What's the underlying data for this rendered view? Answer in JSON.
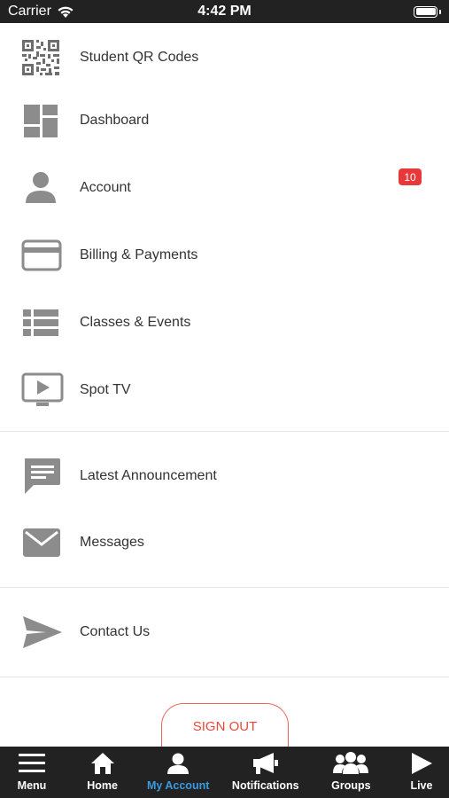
{
  "status_bar": {
    "carrier": "Carrier",
    "time": "4:42 PM"
  },
  "menu": {
    "items": [
      {
        "label": "Student QR Codes",
        "icon": "qr-code-icon"
      },
      {
        "label": "Dashboard",
        "icon": "dashboard-icon"
      },
      {
        "label": "Account",
        "icon": "person-icon",
        "badge": "10"
      },
      {
        "label": "Billing & Payments",
        "icon": "credit-card-icon"
      },
      {
        "label": "Classes & Events",
        "icon": "list-icon"
      },
      {
        "label": "Spot TV",
        "icon": "tv-play-icon"
      },
      {
        "label": "Latest Announcement",
        "icon": "announcement-icon"
      },
      {
        "label": "Messages",
        "icon": "envelope-icon"
      },
      {
        "label": "Contact Us",
        "icon": "send-icon"
      }
    ]
  },
  "sign_out_label": "SIGN OUT",
  "tab_bar": {
    "tabs": [
      {
        "label": "Menu",
        "icon": "hamburger-icon"
      },
      {
        "label": "Home",
        "icon": "home-icon"
      },
      {
        "label": "My Account",
        "icon": "person-icon",
        "active": true
      },
      {
        "label": "Notifications",
        "icon": "megaphone-icon"
      },
      {
        "label": "Groups",
        "icon": "group-icon"
      },
      {
        "label": "Live",
        "icon": "play-icon"
      }
    ]
  },
  "colors": {
    "bar_background": "#222222",
    "active_tab": "#3a9be0",
    "badge": "#e8383a",
    "sign_out": "#e8483a",
    "icon_gray": "#8c8c8c"
  }
}
